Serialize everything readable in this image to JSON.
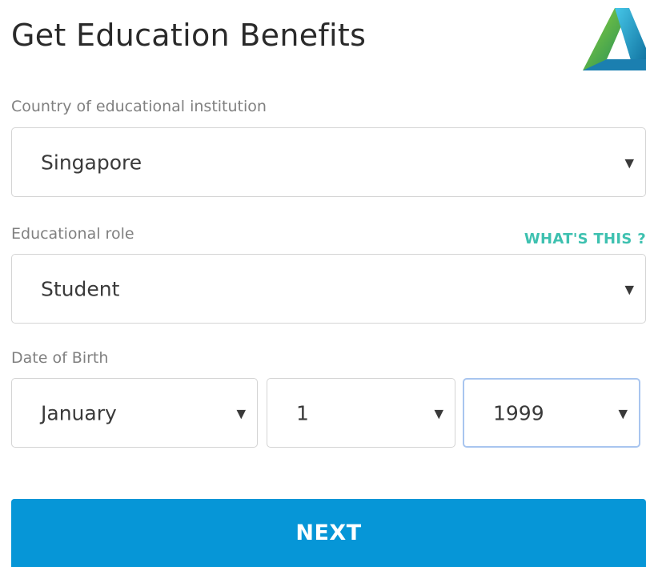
{
  "header": {
    "title": "Get Education Benefits",
    "logo_icon": "autodesk-logo-icon"
  },
  "form": {
    "country": {
      "label": "Country of educational institution",
      "value": "Singapore"
    },
    "role": {
      "label": "Educational role",
      "help_link": "WHAT'S THIS ?",
      "value": "Student"
    },
    "dob": {
      "label": "Date of Birth",
      "month": "January",
      "day": "1",
      "year": "1999"
    },
    "dropdown_icon": "chevron-down-icon",
    "next_label": "NEXT"
  },
  "colors": {
    "primary_button": "#0696d7",
    "help_link": "#3ec1b0",
    "focus_border": "#a8c5ef"
  }
}
